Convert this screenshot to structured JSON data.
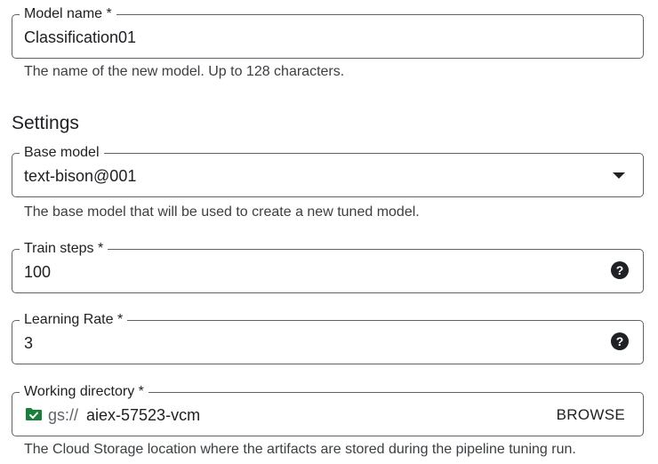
{
  "model_name": {
    "label": "Model name *",
    "value": "Classification01",
    "hint": "The name of the new model. Up to 128 characters."
  },
  "settings": {
    "title": "Settings",
    "base_model": {
      "label": "Base model",
      "value": "text-bison@001",
      "hint": "The base model that will be used to create a new tuned model."
    },
    "train_steps": {
      "label": "Train steps *",
      "value": "100",
      "help_icon": "?"
    },
    "learning_rate": {
      "label": "Learning Rate *",
      "value": "3",
      "help_icon": "?"
    },
    "working_directory": {
      "label": "Working directory *",
      "prefix": "gs://",
      "value": "aiex-57523-vcm",
      "browse_label": "BROWSE",
      "hint": "The Cloud Storage location where the artifacts are stored during the pipeline tuning run."
    }
  },
  "colors": {
    "border": "#5f6368",
    "text": "#202124",
    "folder_icon": "#188038"
  }
}
